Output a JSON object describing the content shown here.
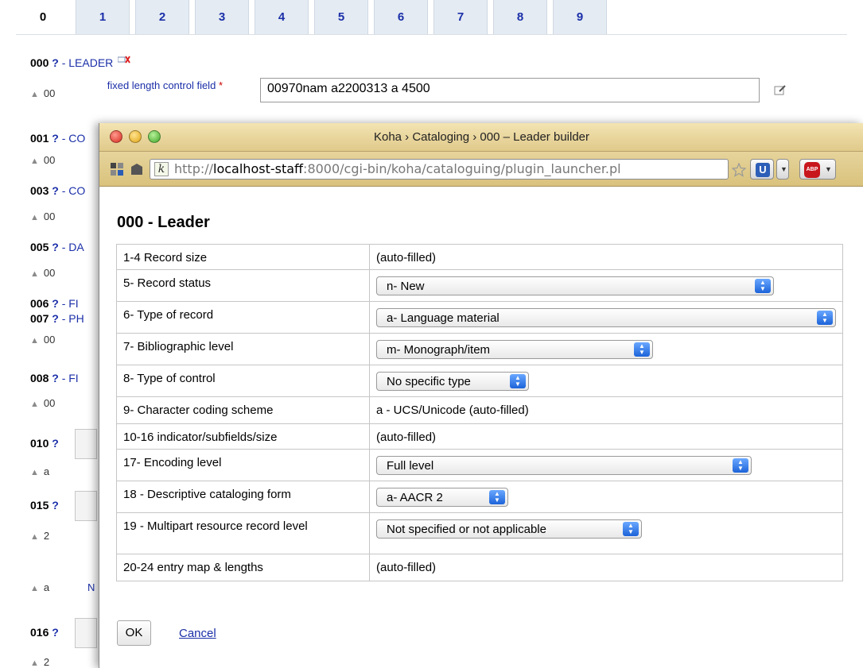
{
  "tabs": [
    "0",
    "1",
    "2",
    "3",
    "4",
    "5",
    "6",
    "7",
    "8",
    "9"
  ],
  "fields": {
    "f000": {
      "tag": "000",
      "q": "?",
      "desc": "- LEADER"
    },
    "f001": {
      "tag": "001",
      "q": "?",
      "desc": "- CO"
    },
    "f003": {
      "tag": "003",
      "q": "?",
      "desc": "- CO"
    },
    "f005": {
      "tag": "005",
      "q": "?",
      "desc": "- DA"
    },
    "f006": {
      "tag": "006",
      "q": "?",
      "desc": "- FI"
    },
    "f007": {
      "tag": "007",
      "q": "?",
      "desc": "- PH"
    },
    "f008": {
      "tag": "008",
      "q": "?",
      "desc": "- FI"
    },
    "f010": {
      "tag": "010",
      "q": "?"
    },
    "f015": {
      "tag": "015",
      "q": "?"
    },
    "f016": {
      "tag": "016",
      "q": "?"
    }
  },
  "subfields": {
    "s1": "00",
    "s2": "00",
    "s3": "00",
    "s4": "00",
    "s5": "00",
    "s6": "00",
    "s7": "a",
    "s8": "2",
    "s9": "a",
    "s10": "2"
  },
  "leader_field": {
    "label": "fixed length control field",
    "required_mark": "*",
    "value": "00970nam a2200313 a 4500"
  },
  "n_label": "N",
  "popup": {
    "window_title": "Koha › Cataloging › 000 – Leader builder",
    "url_scheme": "http://",
    "url_host": "localhost-staff",
    "url_rest": ":8000/cgi-bin/koha/cataloguing/plugin_launcher.pl",
    "k_icon": "k",
    "abp_label": "ABP",
    "u_label": "U",
    "heading": "000 - Leader",
    "rows": [
      {
        "label": "1-4 Record size",
        "value": "(auto-filled)"
      },
      {
        "label": "5- Record status",
        "value": "n- New"
      },
      {
        "label": "6- Type of record",
        "value": "a- Language material"
      },
      {
        "label": "7- Bibliographic level",
        "value": "m- Monograph/item"
      },
      {
        "label": "8- Type of control",
        "value": "No specific type"
      },
      {
        "label": "9- Character coding scheme",
        "value": "a - UCS/Unicode (auto-filled)"
      },
      {
        "label": "10-16 indicator/subfields/size",
        "value": "(auto-filled)"
      },
      {
        "label": "17- Encoding level",
        "value": "Full level"
      },
      {
        "label": "18 - Descriptive cataloging form",
        "value": "a- AACR 2"
      },
      {
        "label": "19 - Multipart resource record level",
        "value": "Not specified or not applicable"
      },
      {
        "label": "20-24 entry map & lengths",
        "value": "(auto-filled)"
      }
    ],
    "ok_label": "OK",
    "cancel_label": "Cancel"
  },
  "colors": {
    "link": "#1b2fa8",
    "tab_bg": "#e4ebf3",
    "titlebar": "#e6d49c"
  }
}
